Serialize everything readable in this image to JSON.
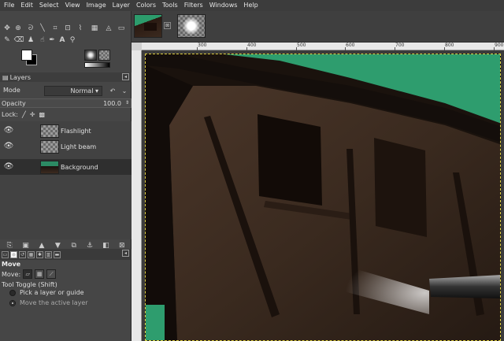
{
  "menubar": {
    "items": [
      "File",
      "Edit",
      "Select",
      "View",
      "Image",
      "Layer",
      "Colors",
      "Tools",
      "Filters",
      "Windows",
      "Help"
    ]
  },
  "toolbox": {
    "tools": [
      "move-icon",
      "align-icon",
      "rect-select-icon",
      "lasso-icon",
      "fuzzy-select-icon",
      "crop-icon",
      "unified-transform-icon",
      "warp-icon",
      "cage-icon",
      "bucket-fill-icon",
      "gradient-icon",
      "paintbrush-icon",
      "eraser-icon",
      "airbrush-icon",
      "clone-icon",
      "smudge-icon",
      "dodge-icon",
      "path-icon",
      "text-icon",
      "zoom-icon"
    ]
  },
  "layers_panel": {
    "title": "Layers",
    "mode_label": "Mode",
    "mode_value": "Normal",
    "opacity_label": "Opacity",
    "opacity_value": "100.0",
    "lock_label": "Lock:",
    "layers": [
      {
        "name": "Flashlight",
        "thumb": "checker"
      },
      {
        "name": "Light beam",
        "thumb": "checker"
      },
      {
        "name": "Background",
        "thumb": "image"
      }
    ],
    "selected_index": 2
  },
  "tool_options": {
    "title": "Move",
    "move_label": "Move:",
    "toggle_label": "Tool Toggle  (Shift)",
    "options": [
      "Pick a layer or guide",
      "Move the active layer"
    ],
    "selected_option": 1
  },
  "ruler": {
    "labels": [
      "300",
      "400",
      "500",
      "600",
      "700",
      "800",
      "900"
    ]
  },
  "colors": {
    "sky": "#2e9d6e",
    "wall": "#3a2a1f",
    "selection_border": "#e0d040"
  }
}
